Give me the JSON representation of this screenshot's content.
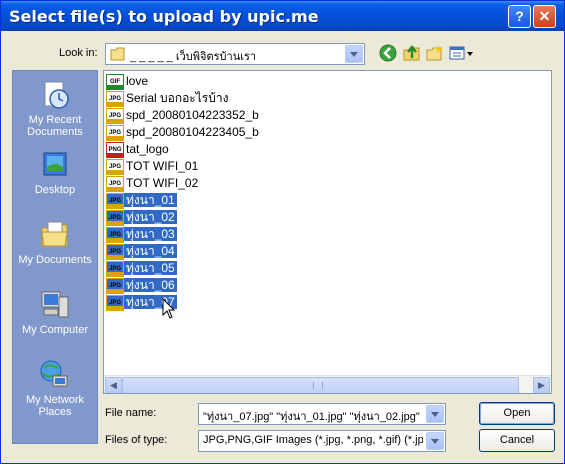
{
  "window": {
    "title": "Select file(s) to upload by upic.me",
    "help_label": "?",
    "close_label": "✕"
  },
  "lookin": {
    "label": "Look in:",
    "value": "_ _ _ _ _ เว็บพิจิตรบ้านเรา"
  },
  "toolbar": {
    "icons": [
      "back-icon",
      "up-folder-icon",
      "new-folder-icon",
      "views-menu-icon"
    ]
  },
  "places": [
    {
      "name": "My Recent Documents",
      "line1": "My Recent",
      "line2": "Documents",
      "icon": "recent-documents-icon"
    },
    {
      "name": "Desktop",
      "line1": "Desktop",
      "line2": "",
      "icon": "desktop-icon"
    },
    {
      "name": "My Documents",
      "line1": "My Documents",
      "line2": "",
      "icon": "my-documents-icon"
    },
    {
      "name": "My Computer",
      "line1": "My Computer",
      "line2": "",
      "icon": "my-computer-icon"
    },
    {
      "name": "My Network Places",
      "line1": "My Network",
      "line2": "Places",
      "icon": "network-places-icon"
    }
  ],
  "files": [
    {
      "name": "love",
      "type": "GIF",
      "selected": false
    },
    {
      "name": "Serial บอกอะไรบ้าง",
      "type": "JPG",
      "selected": false
    },
    {
      "name": "spd_20080104223352_b",
      "type": "JPG",
      "selected": false
    },
    {
      "name": "spd_20080104223405_b",
      "type": "JPG",
      "selected": false
    },
    {
      "name": "tat_logo",
      "type": "PNG",
      "selected": false
    },
    {
      "name": "TOT WIFI_01",
      "type": "JPG",
      "selected": false
    },
    {
      "name": "TOT WIFI_02",
      "type": "JPG",
      "selected": false
    },
    {
      "name": "ทุ่งนา_01",
      "type": "JPG",
      "selected": true
    },
    {
      "name": "ทุ่งนา_02",
      "type": "JPG",
      "selected": true
    },
    {
      "name": "ทุ่งนา_03",
      "type": "JPG",
      "selected": true
    },
    {
      "name": "ทุ่งนา_04",
      "type": "JPG",
      "selected": true
    },
    {
      "name": "ทุ่งนา_05",
      "type": "JPG",
      "selected": true
    },
    {
      "name": "ทุ่งนา_06",
      "type": "JPG",
      "selected": true
    },
    {
      "name": "ทุ่งนา_07",
      "type": "JPG",
      "selected": true
    }
  ],
  "filename": {
    "label": "File name:",
    "value": "\"ทุ่งนา_07.jpg\" \"ทุ่งนา_01.jpg\" \"ทุ่งนา_02.jpg\" \""
  },
  "filetype": {
    "label": "Files of type:",
    "value": "JPG,PNG,GIF Images (*.jpg, *.png, *.gif) (*.jpg;"
  },
  "buttons": {
    "open": "Open",
    "cancel": "Cancel"
  },
  "colors": {
    "title_bar": "#0450d8",
    "selection": "#316ac5",
    "places_bar": "#8098cc",
    "dialog_bg": "#ece9d8"
  }
}
